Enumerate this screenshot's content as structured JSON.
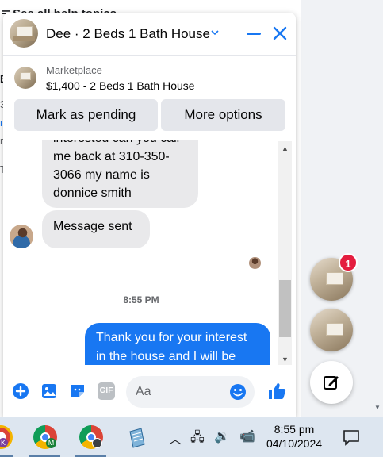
{
  "background": {
    "help_text": "See all help topics",
    "side_fragments": [
      "B",
      "3",
      "n",
      "r",
      "T"
    ]
  },
  "chat": {
    "header_title": "Dee · 2 Beds 1 Bath House",
    "marketplace_label": "Marketplace",
    "listing_title": "$1,400 - 2 Beds 1 Bath House",
    "mark_pending_label": "Mark as pending",
    "more_options_label": "More options",
    "messages": {
      "incoming_1": [
        "interested can you call",
        "me back at 310-350-",
        "3066 my name is",
        "donnice smith"
      ],
      "incoming_2": "Message sent",
      "timestamp": "8:55 PM",
      "outgoing_1": [
        "Thank you for your interest",
        "in the house and I will be"
      ]
    },
    "composer_placeholder": "Aa",
    "gif_label": "GIF"
  },
  "chat_heads": {
    "unread_count": "1"
  },
  "taskbar": {
    "time": "8:55 pm",
    "date": "04/10/2024",
    "chrome_badge": "M",
    "left_badge": "K"
  },
  "colors": {
    "accent": "#1877f2",
    "badge": "#e41e3f"
  }
}
